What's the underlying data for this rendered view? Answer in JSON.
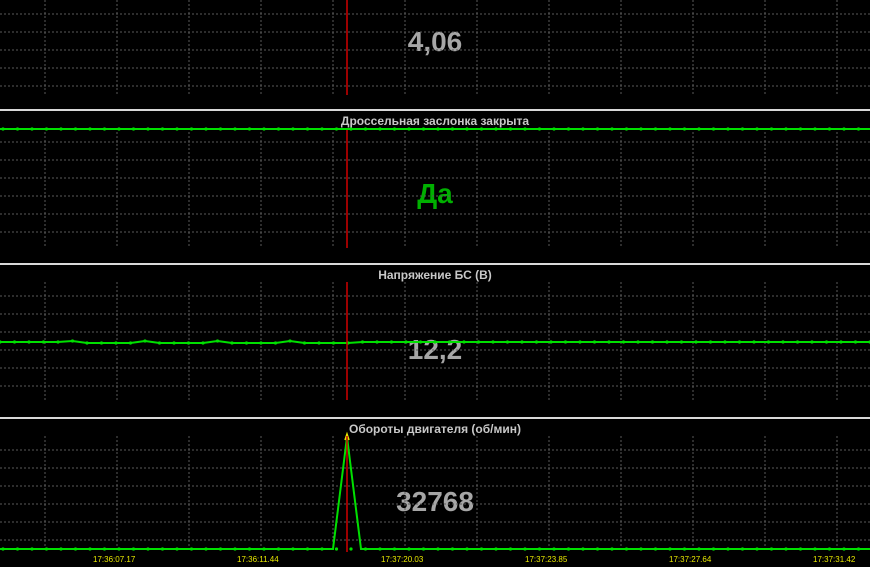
{
  "colors": {
    "grid": "#5a5a5a",
    "series": "#00e000",
    "cursor": "#d00000",
    "value_grey": "#a6a6a6",
    "value_green": "#00b000",
    "tick_label": "#e8e800"
  },
  "panels": [
    {
      "title": "",
      "value": "4,06"
    },
    {
      "title": "Дроссельная заслонка закрыта",
      "value": "Да"
    },
    {
      "title": "Напряжение БС  (В)",
      "value": "12,2"
    },
    {
      "title": "Обороты двигателя  (об/мин)",
      "value": "32768"
    }
  ],
  "x_ticks": [
    "17:36:07.17",
    "17:36:11.44",
    "17:37:20.03",
    "17:37:23.85",
    "17:37:27.64",
    "17:37:31.42"
  ],
  "chart_data": {
    "type": "line",
    "series": [
      {
        "name": "Дроссельная заслонка закрыта",
        "values": "flat"
      },
      {
        "name": "Напряжение БС  (В)",
        "values": "flat ~12,2"
      },
      {
        "name": "Обороты двигателя  (об/мин)",
        "spike_max": 32768
      }
    ]
  }
}
